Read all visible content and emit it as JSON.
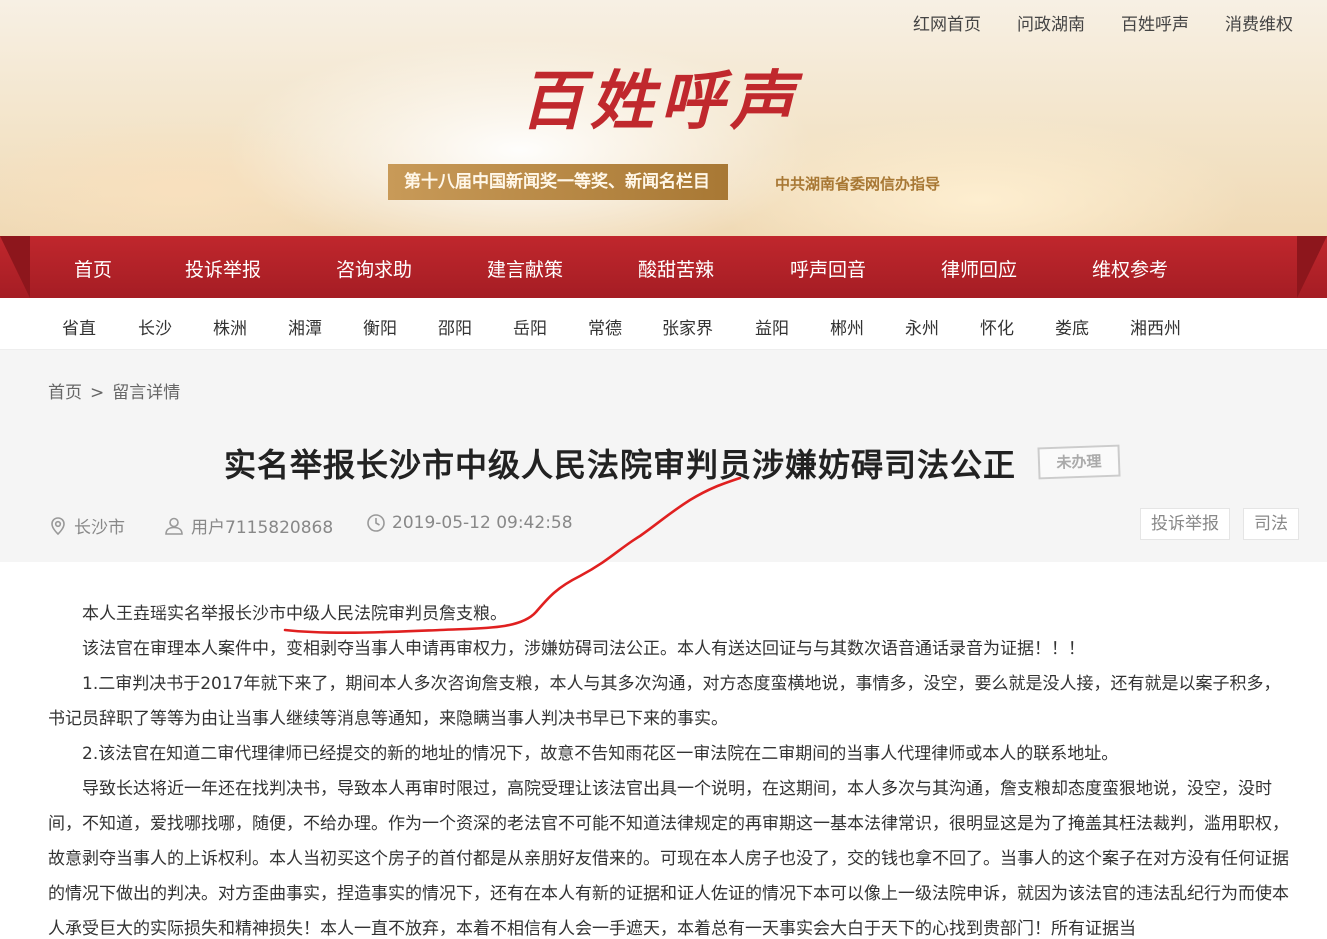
{
  "toplinks": [
    "红网首页",
    "问政湖南",
    "百姓呼声",
    "消费维权"
  ],
  "logo": "百姓呼声",
  "award": "第十八届中国新闻奖一等奖、新闻名栏目",
  "award_sub": "中共湖南省委网信办指导",
  "mainnav": [
    "首页",
    "投诉举报",
    "咨询求助",
    "建言献策",
    "酸甜苦辣",
    "呼声回音",
    "律师回应",
    "维权参考"
  ],
  "citynav": [
    "省直",
    "长沙",
    "株洲",
    "湘潭",
    "衡阳",
    "邵阳",
    "岳阳",
    "常德",
    "张家界",
    "益阳",
    "郴州",
    "永州",
    "怀化",
    "娄底",
    "湘西州"
  ],
  "breadcrumb": {
    "home": "首页",
    "sep": ">",
    "current": "留言详情"
  },
  "article": {
    "title": "实名举报长沙市中级人民法院审判员涉嫌妨碍司法公正",
    "status": "未办理",
    "location": "长沙市",
    "user": "用户7115820868",
    "datetime": "2019-05-12 09:42:58",
    "tags": [
      "投诉举报",
      "司法"
    ],
    "paragraphs": [
      "本人王垚瑶实名举报长沙市中级人民法院审判员詹支粮。",
      "该法官在审理本人案件中，变相剥夺当事人申请再审权力，涉嫌妨碍司法公正。本人有送达回证与与其数次语音通话录音为证据！！！",
      "1.二审判决书于2017年就下来了，期间本人多次咨询詹支粮，本人与其多次沟通，对方态度蛮横地说，事情多，没空，要么就是没人接，还有就是以案子积多，书记员辞职了等等为由让当事人继续等消息等通知，来隐瞒当事人判决书早已下来的事实。",
      "2.该法官在知道二审代理律师已经提交的新的地址的情况下，故意不告知雨花区一审法院在二审期间的当事人代理律师或本人的联系地址。",
      "导致长达将近一年还在找判决书，导致本人再审时限过，高院受理让该法官出具一个说明，在这期间，本人多次与其沟通，詹支粮却态度蛮狠地说，没空，没时间，不知道，爱找哪找哪，随便，不给办理。作为一个资深的老法官不可能不知道法律规定的再审期这一基本法律常识，很明显这是为了掩盖其枉法裁判，滥用职权，故意剥夺当事人的上诉权利。本人当初买这个房子的首付都是从亲朋好友借来的。可现在本人房子也没了，交的钱也拿不回了。当事人的这个案子在对方没有任何证据的情况下做出的判决。对方歪曲事实，捏造事实的情况下，还有在本人有新的证据和证人佐证的情况下本可以像上一级法院申诉，就因为该法官的违法乱纪行为而使本人承受巨大的实际损失和精神损失！本人一直不放弃，本着不相信有人会一手遮天，本着总有一天事实会大白于天下的心找到贵部门！所有证据当"
    ]
  },
  "colors": {
    "brand_red": "#c0272d",
    "annotation_red": "#e02020"
  }
}
